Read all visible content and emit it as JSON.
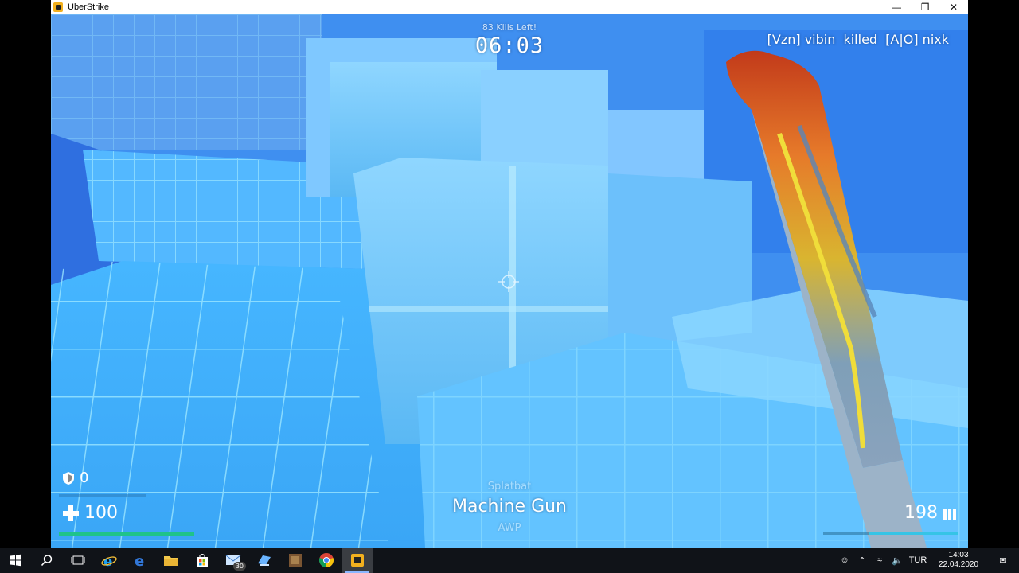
{
  "window": {
    "title": "UberStrike",
    "minimize_glyph": "—",
    "maximize_glyph": "❐",
    "close_glyph": "✕"
  },
  "hud": {
    "kills_left": "83 Kills Left!",
    "timer": "06:03",
    "killfeed": {
      "killer": "[Vzn] vibin",
      "action": "killed",
      "victim": "[A|O] nixk"
    },
    "armor": "0",
    "health": "100",
    "health_fraction": 1.0,
    "weapon_prev": "Splatbat",
    "weapon_current": "Machine Gun",
    "weapon_next": "AWP",
    "ammo": "198",
    "ammo_fraction": 0.66,
    "colors": {
      "health_bar": "#1fc38a",
      "ammo_bar": "#36c4e6"
    }
  },
  "taskbar": {
    "items": [
      {
        "name": "start-icon"
      },
      {
        "name": "search-icon"
      },
      {
        "name": "task-view-icon"
      },
      {
        "name": "internet-explorer-icon"
      },
      {
        "name": "edge-icon"
      },
      {
        "name": "file-explorer-icon"
      },
      {
        "name": "store-icon"
      },
      {
        "name": "mail-icon",
        "badge": "30"
      },
      {
        "name": "steam-icon"
      },
      {
        "name": "game-icon"
      },
      {
        "name": "chrome-icon"
      },
      {
        "name": "uberstrike-icon",
        "active": true
      }
    ],
    "language": "TUR",
    "time": "14:03",
    "date": "22.04.2020"
  }
}
